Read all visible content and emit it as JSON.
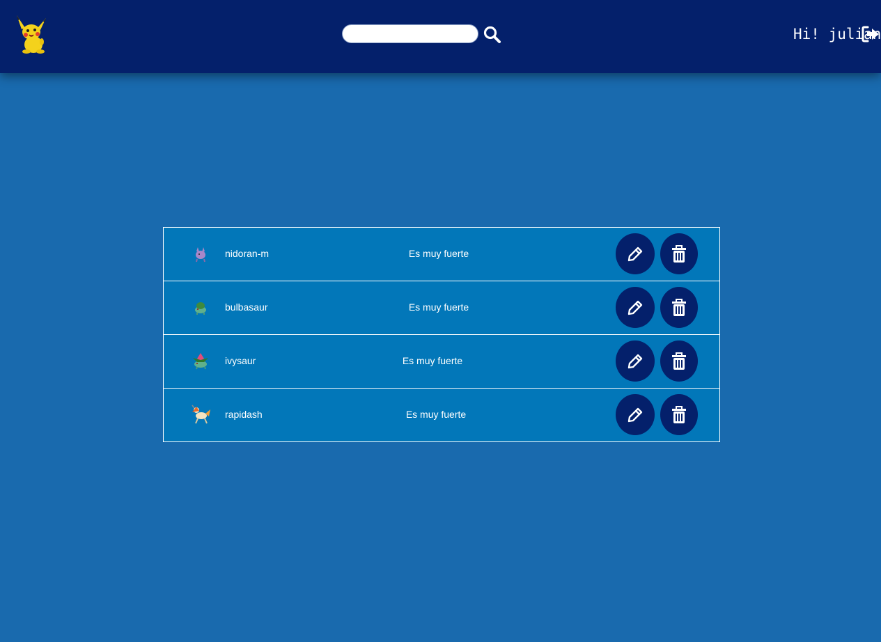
{
  "header": {
    "logo_name": "pikachu-logo",
    "search": {
      "value": "",
      "placeholder": ""
    },
    "greeting": "Hi! julian"
  },
  "pokemon_list": [
    {
      "name": "nidoran-m",
      "description": "Es muy fuerte",
      "sprite": "nidoran-m-sprite"
    },
    {
      "name": "bulbasaur",
      "description": "Es muy fuerte",
      "sprite": "bulbasaur-sprite"
    },
    {
      "name": "ivysaur",
      "description": "Es muy fuerte",
      "sprite": "ivysaur-sprite"
    },
    {
      "name": "rapidash",
      "description": "Es muy fuerte",
      "sprite": "rapidash-sprite"
    }
  ],
  "icons": {
    "search": "search-icon",
    "logout": "sign-out-icon",
    "edit": "pencil-icon",
    "delete": "trash-icon"
  },
  "colors": {
    "navbar": "#04206b",
    "background": "#196aae",
    "row": "#0277b9",
    "button": "#04206b",
    "text": "#ffffff"
  }
}
